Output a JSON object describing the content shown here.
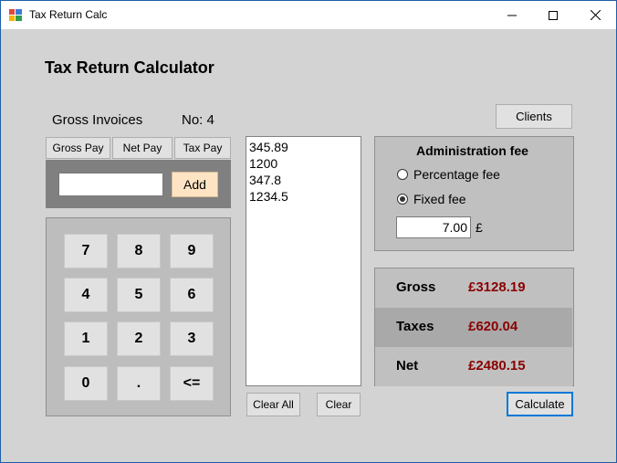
{
  "window": {
    "title": "Tax Return Calc",
    "controls": {
      "minimize": "─",
      "maximize": "☐",
      "close": "✕"
    }
  },
  "main": {
    "heading": "Tax Return Calculator",
    "gross_invoices_label": "Gross Invoices",
    "count_label": "No: 4",
    "tabs": [
      "Gross Pay",
      "Net Pay",
      "Tax Pay"
    ],
    "amount_input": {
      "value": ""
    },
    "add_label": "Add",
    "keypad": [
      "7",
      "8",
      "9",
      "4",
      "5",
      "6",
      "1",
      "2",
      "3",
      "0",
      ".",
      "<="
    ],
    "invoices": [
      "345.89",
      "1200",
      "347.8",
      "1234.5"
    ],
    "clear_all_label": "Clear All",
    "clear_label": "Clear",
    "clients_label": "Clients",
    "calculate_label": "Calculate"
  },
  "admin_fee": {
    "title": "Administration fee",
    "options": [
      {
        "label": "Percentage fee",
        "checked": false
      },
      {
        "label": "Fixed fee",
        "checked": true
      }
    ],
    "fee_value": "7.00",
    "currency": "£"
  },
  "results": [
    {
      "label": "Gross",
      "value": "£3128.19"
    },
    {
      "label": "Taxes",
      "value": "£620.04"
    },
    {
      "label": "Net",
      "value": "£2480.15"
    }
  ],
  "colors": {
    "accent_value": "#8b0000",
    "add_button": "#ffe4c4",
    "calculate_border": "#0078d7"
  }
}
